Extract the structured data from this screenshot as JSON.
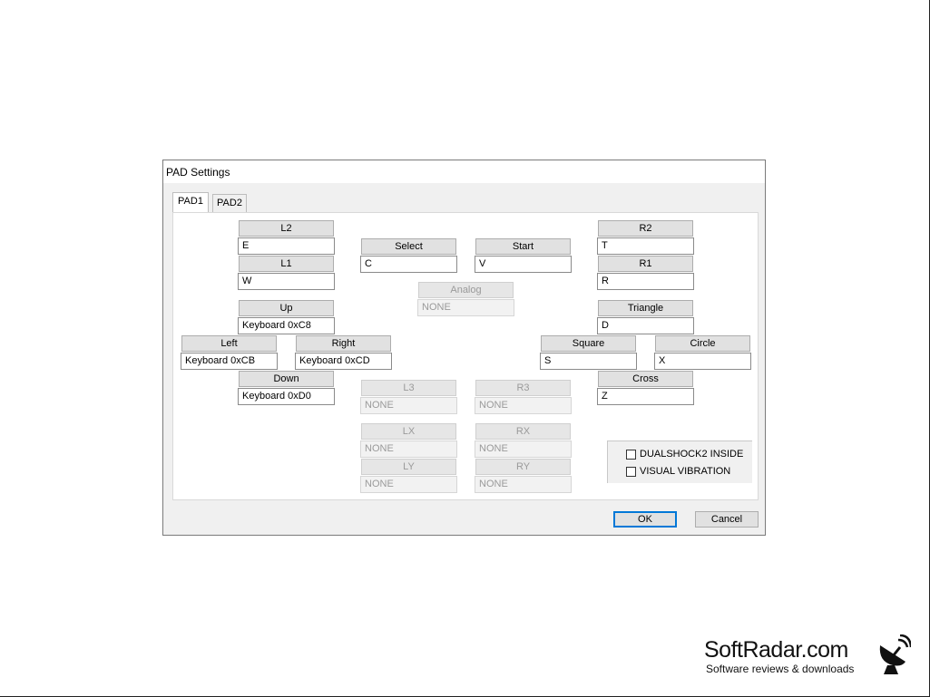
{
  "dialog": {
    "title": "PAD Settings",
    "tabs": [
      {
        "label": "PAD1"
      },
      {
        "label": "PAD2"
      }
    ],
    "mappings": {
      "l2": {
        "label": "L2",
        "value": "E"
      },
      "l1": {
        "label": "L1",
        "value": "W"
      },
      "up": {
        "label": "Up",
        "value": "Keyboard 0xC8"
      },
      "left": {
        "label": "Left",
        "value": "Keyboard 0xCB"
      },
      "right": {
        "label": "Right",
        "value": "Keyboard 0xCD"
      },
      "down": {
        "label": "Down",
        "value": "Keyboard 0xD0"
      },
      "select": {
        "label": "Select",
        "value": "C"
      },
      "start": {
        "label": "Start",
        "value": "V"
      },
      "analog": {
        "label": "Analog",
        "value": "NONE"
      },
      "l3": {
        "label": "L3",
        "value": "NONE"
      },
      "r3": {
        "label": "R3",
        "value": "NONE"
      },
      "lx": {
        "label": "LX",
        "value": "NONE"
      },
      "rx": {
        "label": "RX",
        "value": "NONE"
      },
      "ly": {
        "label": "LY",
        "value": "NONE"
      },
      "ry": {
        "label": "RY",
        "value": "NONE"
      },
      "r2": {
        "label": "R2",
        "value": "T"
      },
      "r1": {
        "label": "R1",
        "value": "R"
      },
      "triangle": {
        "label": "Triangle",
        "value": "D"
      },
      "square": {
        "label": "Square",
        "value": "S"
      },
      "circle": {
        "label": "Circle",
        "value": "X"
      },
      "cross": {
        "label": "Cross",
        "value": "Z"
      }
    },
    "options": {
      "dualshock2": {
        "label": "DUALSHOCK2 INSIDE",
        "checked": false
      },
      "vibration": {
        "label": "VISUAL VIBRATION",
        "checked": false
      }
    },
    "ok_label": "OK",
    "cancel_label": "Cancel"
  },
  "watermark": {
    "name": "SoftRadar.com",
    "tagline": "Software reviews & downloads",
    "icon": "satellite-dish-icon"
  }
}
